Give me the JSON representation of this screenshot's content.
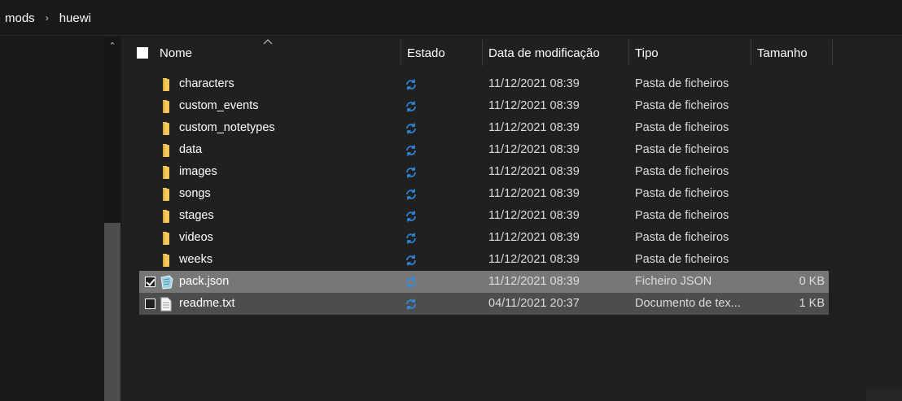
{
  "breadcrumb": {
    "items": [
      "mods",
      "huewi"
    ]
  },
  "columns": {
    "name": "Nome",
    "status": "Estado",
    "modified": "Data de modificação",
    "type": "Tipo",
    "size": "Tamanho"
  },
  "rows": [
    {
      "name": "characters",
      "kind": "folder",
      "date": "11/12/2021 08:39",
      "type": "Pasta de ficheiros",
      "size": ""
    },
    {
      "name": "custom_events",
      "kind": "folder",
      "date": "11/12/2021 08:39",
      "type": "Pasta de ficheiros",
      "size": ""
    },
    {
      "name": "custom_notetypes",
      "kind": "folder",
      "date": "11/12/2021 08:39",
      "type": "Pasta de ficheiros",
      "size": ""
    },
    {
      "name": "data",
      "kind": "folder",
      "date": "11/12/2021 08:39",
      "type": "Pasta de ficheiros",
      "size": ""
    },
    {
      "name": "images",
      "kind": "folder",
      "date": "11/12/2021 08:39",
      "type": "Pasta de ficheiros",
      "size": ""
    },
    {
      "name": "songs",
      "kind": "folder",
      "date": "11/12/2021 08:39",
      "type": "Pasta de ficheiros",
      "size": ""
    },
    {
      "name": "stages",
      "kind": "folder",
      "date": "11/12/2021 08:39",
      "type": "Pasta de ficheiros",
      "size": ""
    },
    {
      "name": "videos",
      "kind": "folder",
      "date": "11/12/2021 08:39",
      "type": "Pasta de ficheiros",
      "size": ""
    },
    {
      "name": "weeks",
      "kind": "folder",
      "date": "11/12/2021 08:39",
      "type": "Pasta de ficheiros",
      "size": ""
    },
    {
      "name": "pack.json",
      "kind": "json",
      "date": "11/12/2021 08:39",
      "type": "Ficheiro JSON",
      "size": "0 KB",
      "checked": true
    },
    {
      "name": "readme.txt",
      "kind": "text",
      "date": "04/11/2021 20:37",
      "type": "Documento de tex...",
      "size": "1 KB",
      "checked": false
    }
  ],
  "colors": {
    "sync": "#2f8fe8",
    "folder": "#f2c75c",
    "selected_row": "#777777",
    "hover_row": "#4d4d4d"
  }
}
